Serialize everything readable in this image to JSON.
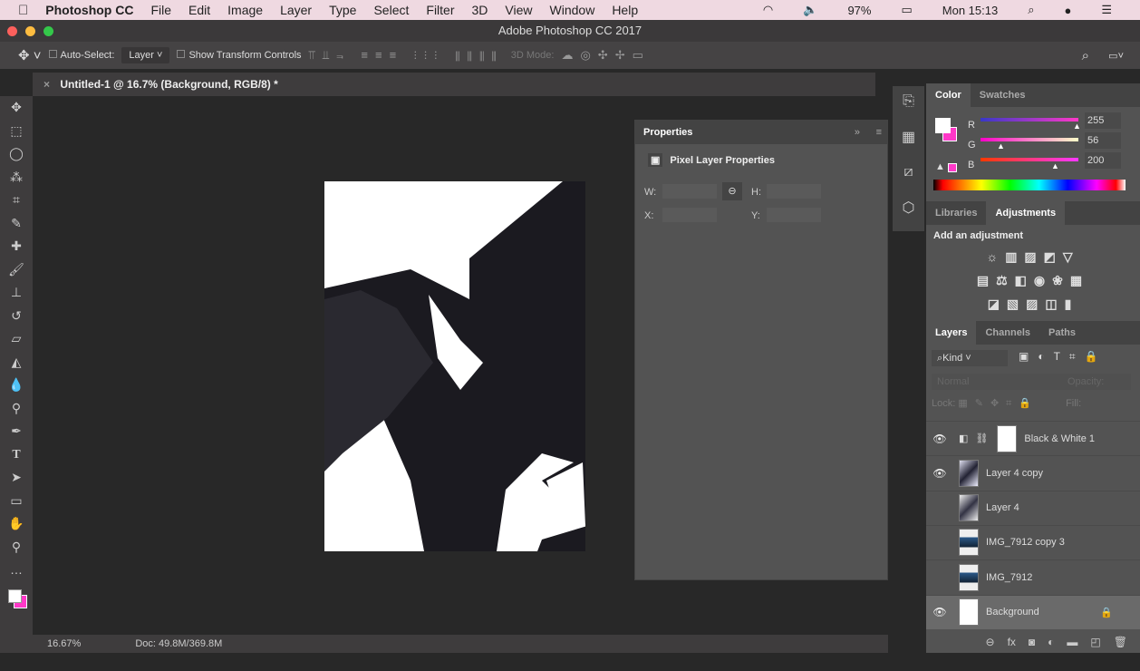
{
  "menubar": {
    "app": "Photoshop CC",
    "items": [
      "File",
      "Edit",
      "Image",
      "Layer",
      "Type",
      "Select",
      "Filter",
      "3D",
      "View",
      "Window",
      "Help"
    ],
    "battery": "97%",
    "clock": "Mon 15:13"
  },
  "window": {
    "title": "Adobe Photoshop CC 2017"
  },
  "options": {
    "auto_select": "Auto-Select:",
    "auto_select_value": "Layer",
    "transform": "Show Transform Controls",
    "mode3d": "3D Mode:"
  },
  "document": {
    "tab": "Untitled-1 @ 16.7% (Background, RGB/8) *",
    "zoom": "16.67%",
    "doc_size": "Doc: 49.8M/369.8M"
  },
  "properties": {
    "title": "Properties",
    "subtitle": "Pixel Layer Properties",
    "w": "W:",
    "h": "H:",
    "x": "X:",
    "y": "Y:"
  },
  "color": {
    "tabs": [
      "Color",
      "Swatches"
    ],
    "r_label": "R",
    "g_label": "G",
    "b_label": "B",
    "r": "255",
    "g": "56",
    "b": "200",
    "foreground": "#ffffff",
    "background": "#ff38c8"
  },
  "adjustments": {
    "tabs": [
      "Libraries",
      "Adjustments"
    ],
    "heading": "Add an adjustment"
  },
  "layers": {
    "tabs": [
      "Layers",
      "Channels",
      "Paths"
    ],
    "filter": "Kind",
    "blend": "Normal",
    "opacity": "Opacity:",
    "lock": "Lock:",
    "fill": "Fill:",
    "items": [
      {
        "name": "Black & White 1",
        "visible": true
      },
      {
        "name": "Layer 4 copy",
        "visible": true
      },
      {
        "name": "Layer 4",
        "visible": false
      },
      {
        "name": "IMG_7912 copy 3",
        "visible": false
      },
      {
        "name": "IMG_7912",
        "visible": false
      },
      {
        "name": "Background",
        "visible": true,
        "locked": true
      }
    ]
  }
}
